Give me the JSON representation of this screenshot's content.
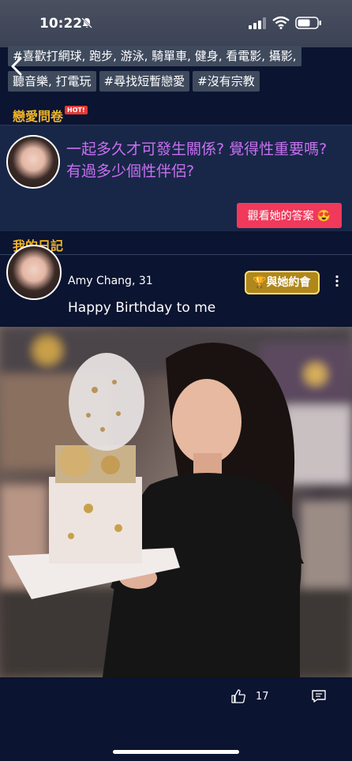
{
  "status_bar": {
    "time": "10:22"
  },
  "profile": {
    "tags": [
      "#喜歡打網球, 跑步, 游泳, 騎單車, 健身, 看電影, 攝影,",
      "聽音樂, 打電玩",
      "#尋找短暫戀愛",
      "#沒有宗教"
    ]
  },
  "questionnaire": {
    "title": "戀愛問卷",
    "hot_badge": "HOT!",
    "question": "一起多久才可發生關係? 覺得性重要嗎? 有過多少個性伴侶?",
    "answer_button": "觀看她的答案 😍"
  },
  "diary": {
    "title": "我的日記",
    "post": {
      "author": "Amy Chang, 31",
      "text": "Happy Birthday to me",
      "date_button": "與她約會",
      "likes": "17"
    }
  },
  "colors": {
    "accent_gold": "#f0b429",
    "question_purple": "#c870f0",
    "answer_button": "#f0395b",
    "background": "#0b1430"
  }
}
